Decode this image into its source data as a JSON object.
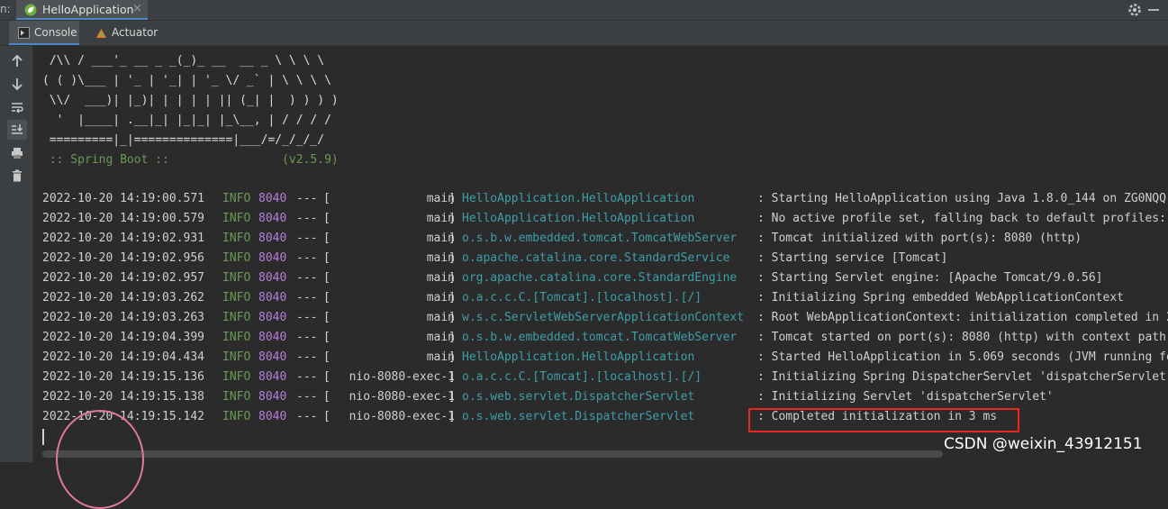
{
  "run_bar": {
    "label": "n:",
    "tab_title": "HelloApplication",
    "close_glyph": "×",
    "spring_icon": "spring-leaf-icon",
    "settings_icon": "gear-icon",
    "minimize_icon": "minimize-icon",
    "accent_color": "#4a88c7"
  },
  "tabs": [
    {
      "label": "Console",
      "icon": "console-icon"
    },
    {
      "label": "Actuator",
      "icon": "actuator-icon"
    }
  ],
  "toolbar_icons": [
    "arrow-up-icon",
    "arrow-down-icon",
    "soft-wrap-icon",
    "scroll-to-end-icon",
    "print-icon",
    "trash-icon"
  ],
  "banner": {
    "lines": [
      " /\\\\ / ___'_ __ _ _(_)_ __  __ _ \\ \\ \\ \\",
      "( ( )\\___ | '_ | '_| | '_ \\/ _` | \\ \\ \\ \\",
      " \\\\/  ___)| |_)| | | | | || (_| |  ) ) ) )",
      "  '  |____| .__|_| |_|_| |_\\__, | / / / /",
      " =========|_|==============|___/=/_/_/_/"
    ],
    "spring_line": " :: Spring Boot ::                (v2.5.9)"
  },
  "log": [
    {
      "ts": "2022-10-20 14:19:00.571",
      "level": "INFO",
      "pid": "8040",
      "sep": "---",
      "thread": "main",
      "logger": "HelloApplication.HelloApplication",
      "msg": ": Starting HelloApplication using Java 1.8.0_144 on ZG0NQQ"
    },
    {
      "ts": "2022-10-20 14:19:00.579",
      "level": "INFO",
      "pid": "8040",
      "sep": "---",
      "thread": "main",
      "logger": "HelloApplication.HelloApplication",
      "msg": ": No active profile set, falling back to default profiles:"
    },
    {
      "ts": "2022-10-20 14:19:02.931",
      "level": "INFO",
      "pid": "8040",
      "sep": "---",
      "thread": "main",
      "logger": "o.s.b.w.embedded.tomcat.TomcatWebServer",
      "msg": ": Tomcat initialized with port(s): 8080 (http)"
    },
    {
      "ts": "2022-10-20 14:19:02.956",
      "level": "INFO",
      "pid": "8040",
      "sep": "---",
      "thread": "main",
      "logger": "o.apache.catalina.core.StandardService",
      "msg": ": Starting service [Tomcat]"
    },
    {
      "ts": "2022-10-20 14:19:02.957",
      "level": "INFO",
      "pid": "8040",
      "sep": "---",
      "thread": "main",
      "logger": "org.apache.catalina.core.StandardEngine",
      "msg": ": Starting Servlet engine: [Apache Tomcat/9.0.56]"
    },
    {
      "ts": "2022-10-20 14:19:03.262",
      "level": "INFO",
      "pid": "8040",
      "sep": "---",
      "thread": "main",
      "logger": "o.a.c.c.C.[Tomcat].[localhost].[/]",
      "msg": ": Initializing Spring embedded WebApplicationContext"
    },
    {
      "ts": "2022-10-20 14:19:03.263",
      "level": "INFO",
      "pid": "8040",
      "sep": "---",
      "thread": "main",
      "logger": "w.s.c.ServletWebServerApplicationContext",
      "msg": ": Root WebApplicationContext: initialization completed in 2"
    },
    {
      "ts": "2022-10-20 14:19:04.399",
      "level": "INFO",
      "pid": "8040",
      "sep": "---",
      "thread": "main",
      "logger": "o.s.b.w.embedded.tomcat.TomcatWebServer",
      "msg": ": Tomcat started on port(s): 8080 (http) with context path"
    },
    {
      "ts": "2022-10-20 14:19:04.434",
      "level": "INFO",
      "pid": "8040",
      "sep": "---",
      "thread": "main",
      "logger": "HelloApplication.HelloApplication",
      "msg": ": Started HelloApplication in 5.069 seconds (JVM running fo"
    },
    {
      "ts": "2022-10-20 14:19:15.136",
      "level": "INFO",
      "pid": "8040",
      "sep": "---",
      "thread": "nio-8080-exec-1",
      "logger": "o.a.c.c.C.[Tomcat].[localhost].[/]",
      "msg": ": Initializing Spring DispatcherServlet 'dispatcherServlet"
    },
    {
      "ts": "2022-10-20 14:19:15.138",
      "level": "INFO",
      "pid": "8040",
      "sep": "---",
      "thread": "nio-8080-exec-1",
      "logger": "o.s.web.servlet.DispatcherServlet",
      "msg": ": Initializing Servlet 'dispatcherServlet'"
    },
    {
      "ts": "2022-10-20 14:19:15.142",
      "level": "INFO",
      "pid": "8040",
      "sep": "---",
      "thread": "nio-8080-exec-1",
      "logger": "o.s.web.servlet.DispatcherServlet",
      "msg": ": Completed initialization in 3 ms"
    }
  ],
  "colors": {
    "level": "#6a9955",
    "pid": "#b57edc",
    "logger": "#3e9ea8",
    "highlight_box": "#e8261f"
  },
  "watermark": "CSDN @weixin_43912151"
}
